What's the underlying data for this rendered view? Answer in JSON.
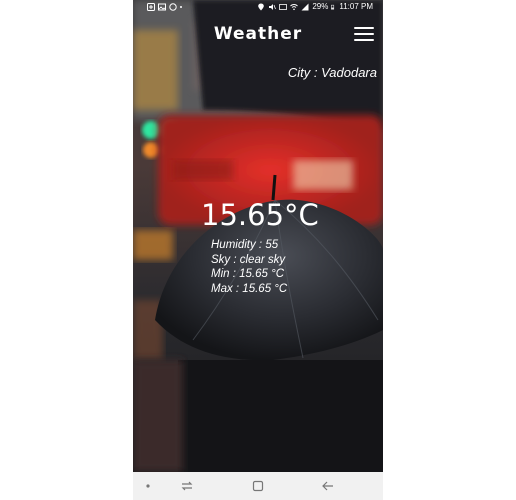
{
  "status_bar": {
    "battery": "29%",
    "time": "11:07 PM"
  },
  "header": {
    "title": "Weather"
  },
  "weather": {
    "city": "City : Vadodara",
    "temperature": "15.65°C",
    "humidity": "Humidity : 55",
    "sky": "Sky : clear sky",
    "min": "Min : 15.65 °C",
    "max": "Max : 15.65 °C"
  },
  "icons": {
    "menu": "hamburger-menu-icon",
    "nav_dot": "dot-icon",
    "nav_recent": "recent-apps-icon",
    "nav_home": "home-icon",
    "nav_back": "back-arrow-icon"
  }
}
